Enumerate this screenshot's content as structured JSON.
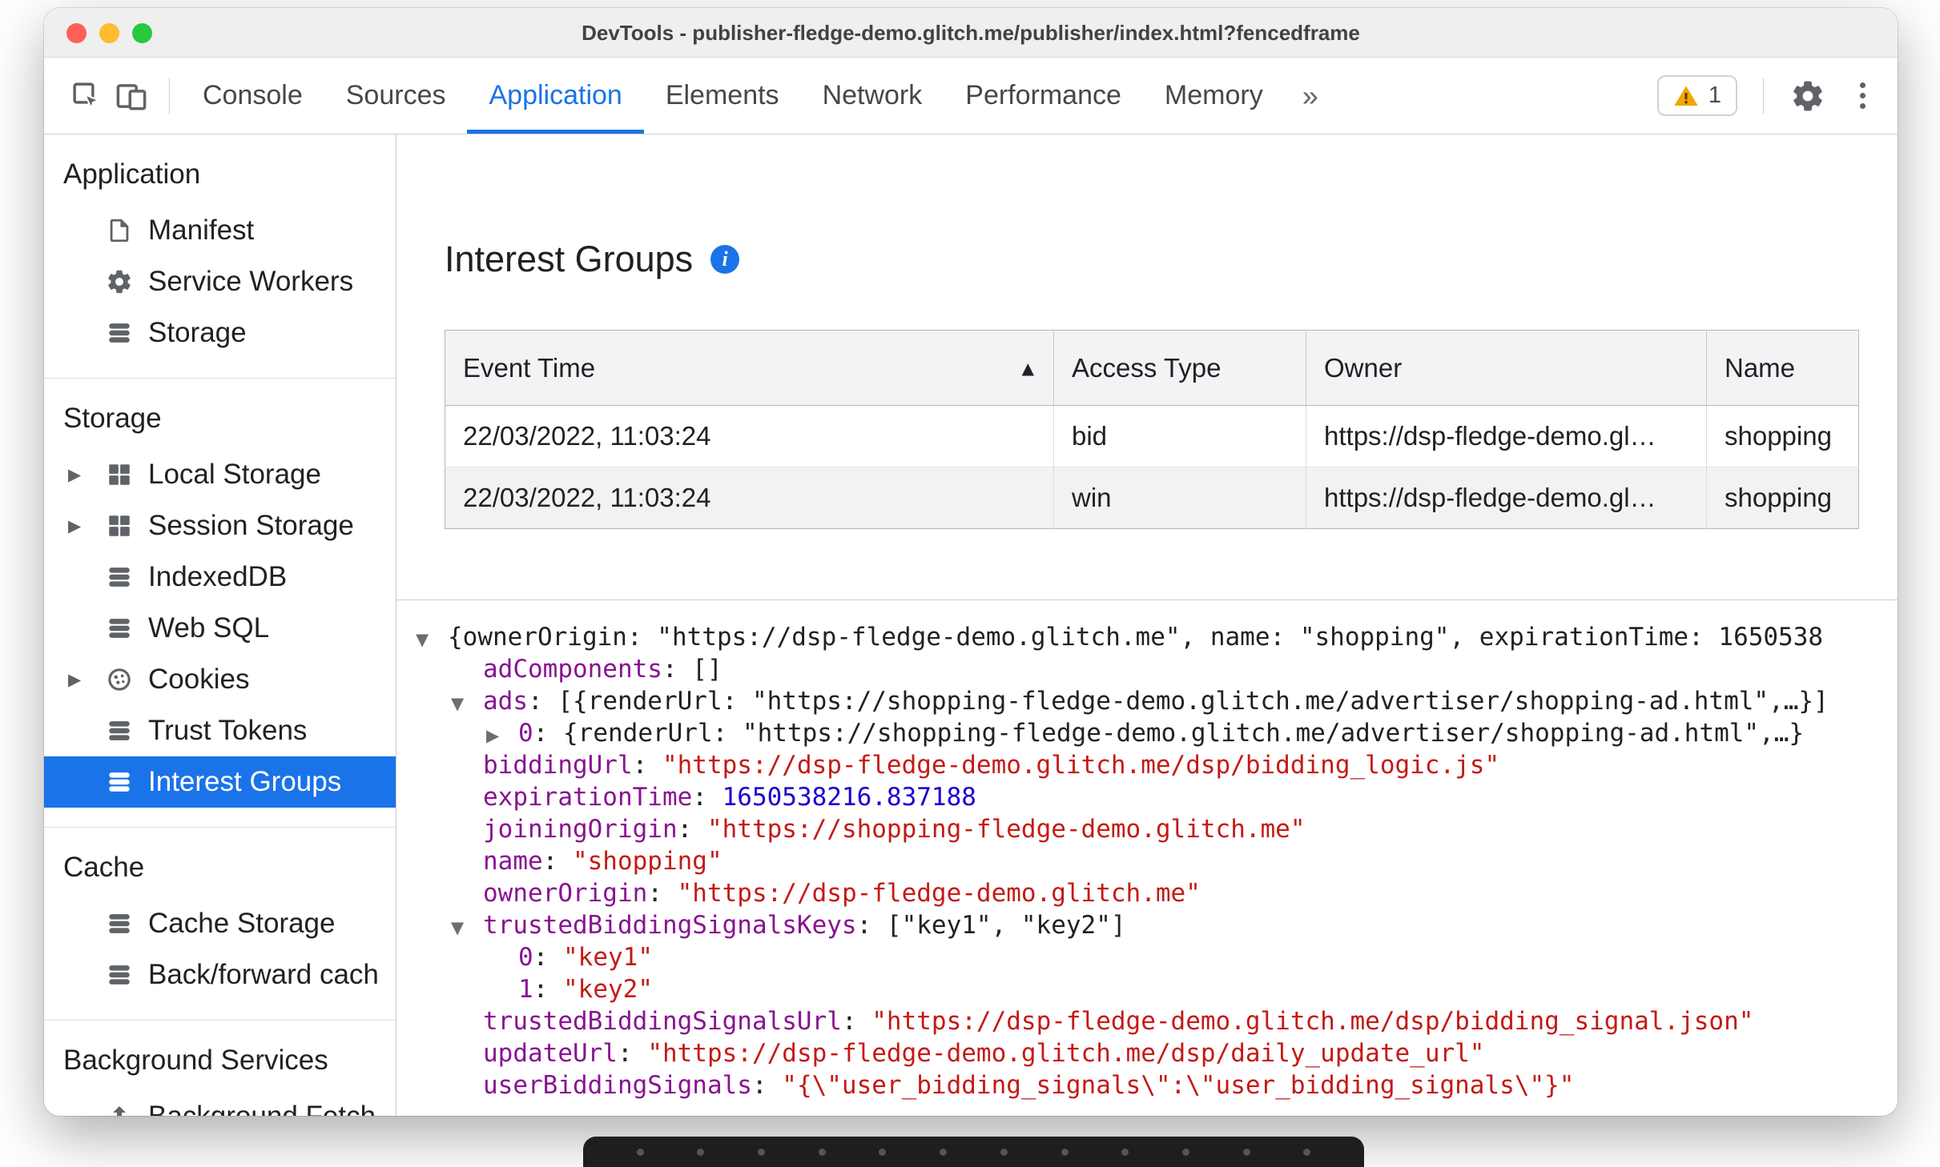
{
  "window": {
    "title": "DevTools - publisher-fledge-demo.glitch.me/publisher/index.html?fencedframe"
  },
  "toolbar": {
    "tabs": [
      {
        "label": "Console",
        "active": false
      },
      {
        "label": "Sources",
        "active": false
      },
      {
        "label": "Application",
        "active": true
      },
      {
        "label": "Elements",
        "active": false
      },
      {
        "label": "Network",
        "active": false
      },
      {
        "label": "Performance",
        "active": false
      },
      {
        "label": "Memory",
        "active": false
      }
    ],
    "more_tabs": "»",
    "issues_count": "1"
  },
  "sidebar": {
    "sections": [
      {
        "header": "Application",
        "items": [
          {
            "label": "Manifest",
            "icon": "file-icon",
            "expandable": false,
            "selected": false
          },
          {
            "label": "Service Workers",
            "icon": "gear-icon",
            "expandable": false,
            "selected": false
          },
          {
            "label": "Storage",
            "icon": "stack-icon",
            "expandable": false,
            "selected": false
          }
        ]
      },
      {
        "header": "Storage",
        "items": [
          {
            "label": "Local Storage",
            "icon": "grid-icon",
            "expandable": true,
            "selected": false
          },
          {
            "label": "Session Storage",
            "icon": "grid-icon",
            "expandable": true,
            "selected": false
          },
          {
            "label": "IndexedDB",
            "icon": "stack-icon",
            "expandable": false,
            "selected": false
          },
          {
            "label": "Web SQL",
            "icon": "stack-icon",
            "expandable": false,
            "selected": false
          },
          {
            "label": "Cookies",
            "icon": "cookie-icon",
            "expandable": true,
            "selected": false
          },
          {
            "label": "Trust Tokens",
            "icon": "stack-icon",
            "expandable": false,
            "selected": false
          },
          {
            "label": "Interest Groups",
            "icon": "stack-icon",
            "expandable": false,
            "selected": true
          }
        ]
      },
      {
        "header": "Cache",
        "items": [
          {
            "label": "Cache Storage",
            "icon": "stack-icon",
            "expandable": false,
            "selected": false
          },
          {
            "label": "Back/forward cach",
            "icon": "stack-icon",
            "expandable": false,
            "selected": false
          }
        ]
      },
      {
        "header": "Background Services",
        "items": [
          {
            "label": "Background Fetch",
            "icon": "fetch-icon",
            "expandable": false,
            "selected": false
          }
        ]
      }
    ]
  },
  "main": {
    "title": "Interest Groups",
    "table": {
      "columns": [
        "Event Time",
        "Access Type",
        "Owner",
        "Name"
      ],
      "sorted_column": "Event Time",
      "rows": [
        [
          "22/03/2022, 11:03:24",
          "bid",
          "https://dsp-fledge-demo.gl…",
          "shopping"
        ],
        [
          "22/03/2022, 11:03:24",
          "win",
          "https://dsp-fledge-demo.gl…",
          "shopping"
        ]
      ]
    },
    "tree": {
      "lines": [
        {
          "indent": 0,
          "marker": "down",
          "segments": [
            {
              "type": "plain",
              "text": "{ownerOrigin: \"https://dsp-fledge-demo.glitch.me\", name: \"shopping\", expirationTime: 1650538"
            }
          ]
        },
        {
          "indent": 1,
          "marker": "none",
          "segments": [
            {
              "type": "key",
              "text": "adComponents"
            },
            {
              "type": "plain",
              "text": ": []"
            }
          ]
        },
        {
          "indent": 1,
          "marker": "down",
          "segments": [
            {
              "type": "key",
              "text": "ads"
            },
            {
              "type": "plain",
              "text": ": [{renderUrl: \"https://shopping-fledge-demo.glitch.me/advertiser/shopping-ad.html\",…}]"
            }
          ]
        },
        {
          "indent": 2,
          "marker": "right",
          "segments": [
            {
              "type": "key",
              "text": "0"
            },
            {
              "type": "plain",
              "text": ": {renderUrl: \"https://shopping-fledge-demo.glitch.me/advertiser/shopping-ad.html\",…}"
            }
          ]
        },
        {
          "indent": 1,
          "marker": "none",
          "segments": [
            {
              "type": "key",
              "text": "biddingUrl"
            },
            {
              "type": "plain",
              "text": ": "
            },
            {
              "type": "str",
              "text": "\"https://dsp-fledge-demo.glitch.me/dsp/bidding_logic.js\""
            }
          ]
        },
        {
          "indent": 1,
          "marker": "none",
          "segments": [
            {
              "type": "key",
              "text": "expirationTime"
            },
            {
              "type": "plain",
              "text": ": "
            },
            {
              "type": "num",
              "text": "1650538216.837188"
            }
          ]
        },
        {
          "indent": 1,
          "marker": "none",
          "segments": [
            {
              "type": "key",
              "text": "joiningOrigin"
            },
            {
              "type": "plain",
              "text": ": "
            },
            {
              "type": "str",
              "text": "\"https://shopping-fledge-demo.glitch.me\""
            }
          ]
        },
        {
          "indent": 1,
          "marker": "none",
          "segments": [
            {
              "type": "key",
              "text": "name"
            },
            {
              "type": "plain",
              "text": ": "
            },
            {
              "type": "str",
              "text": "\"shopping\""
            }
          ]
        },
        {
          "indent": 1,
          "marker": "none",
          "segments": [
            {
              "type": "key",
              "text": "ownerOrigin"
            },
            {
              "type": "plain",
              "text": ": "
            },
            {
              "type": "str",
              "text": "\"https://dsp-fledge-demo.glitch.me\""
            }
          ]
        },
        {
          "indent": 1,
          "marker": "down",
          "segments": [
            {
              "type": "key",
              "text": "trustedBiddingSignalsKeys"
            },
            {
              "type": "plain",
              "text": ": [\"key1\", \"key2\"]"
            }
          ]
        },
        {
          "indent": 2,
          "marker": "none",
          "segments": [
            {
              "type": "key",
              "text": "0"
            },
            {
              "type": "plain",
              "text": ": "
            },
            {
              "type": "str",
              "text": "\"key1\""
            }
          ]
        },
        {
          "indent": 2,
          "marker": "none",
          "segments": [
            {
              "type": "key",
              "text": "1"
            },
            {
              "type": "plain",
              "text": ": "
            },
            {
              "type": "str",
              "text": "\"key2\""
            }
          ]
        },
        {
          "indent": 1,
          "marker": "none",
          "segments": [
            {
              "type": "key",
              "text": "trustedBiddingSignalsUrl"
            },
            {
              "type": "plain",
              "text": ": "
            },
            {
              "type": "str",
              "text": "\"https://dsp-fledge-demo.glitch.me/dsp/bidding_signal.json\""
            }
          ]
        },
        {
          "indent": 1,
          "marker": "none",
          "segments": [
            {
              "type": "key",
              "text": "updateUrl"
            },
            {
              "type": "plain",
              "text": ": "
            },
            {
              "type": "str",
              "text": "\"https://dsp-fledge-demo.glitch.me/dsp/daily_update_url\""
            }
          ]
        },
        {
          "indent": 1,
          "marker": "none",
          "segments": [
            {
              "type": "key",
              "text": "userBiddingSignals"
            },
            {
              "type": "plain",
              "text": ": "
            },
            {
              "type": "str",
              "text": "\"{\\\"user_bidding_signals\\\":\\\"user_bidding_signals\\\"}\""
            }
          ]
        }
      ]
    }
  },
  "icons": {
    "expand": "▶",
    "collapse": "▼",
    "sort_asc": "▲",
    "info": "i"
  },
  "colors": {
    "accent": "#1a73e8",
    "key": "#881391",
    "str": "#c41a16",
    "num": "#1c00cf",
    "warn": "#f0a800",
    "traffic-red": "#ff5f57",
    "traffic-yellow": "#febc2e",
    "traffic-green": "#28c840"
  }
}
